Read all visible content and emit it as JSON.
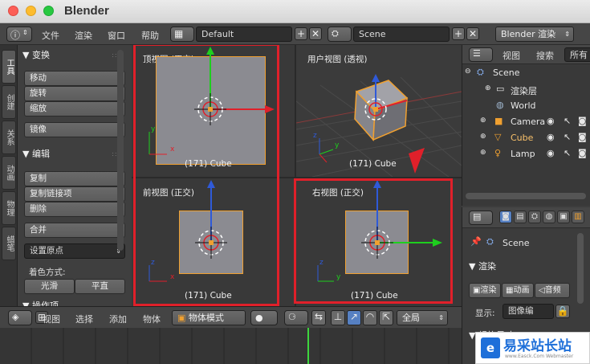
{
  "window": {
    "title": "Blender"
  },
  "infobar": {
    "menus": [
      "文件",
      "渲染",
      "窗口",
      "帮助"
    ],
    "screen_layout": "Default",
    "scene": "Scene",
    "render_engine": "Blender 渲染"
  },
  "left_tabs": [
    "工具",
    "创建",
    "关系",
    "动画",
    "物理",
    "蜡笔"
  ],
  "tool_panel": {
    "transform_header": "▼ 变换",
    "transform_buttons": [
      "移动",
      "旋转",
      "缩放"
    ],
    "mirror": "镜像",
    "edit_header": "▼ 编辑",
    "edit_buttons": [
      "复制",
      "复制链接项",
      "删除"
    ],
    "join": "合并",
    "set_origin": "设置原点",
    "shading_label": "着色方式:",
    "smooth": "光滑",
    "flat": "平直",
    "history_header": "▼ 操作项"
  },
  "viewports": {
    "top": {
      "title": "顶视图 (正交)",
      "object": "(171) Cube"
    },
    "user": {
      "title": "用户视图 (透视)",
      "object": "(171) Cube"
    },
    "front": {
      "title": "前视图 (正交)",
      "object": "(171) Cube"
    },
    "right": {
      "title": "右视图 (正交)",
      "object": "(171) Cube"
    }
  },
  "view_header": {
    "menus": [
      "视图",
      "选择",
      "添加",
      "物体"
    ],
    "mode": "物体模式",
    "orientation": "全局"
  },
  "outliner": {
    "header_menus": [
      "视图",
      "搜索"
    ],
    "filter": "所有",
    "items": [
      {
        "label": "Scene",
        "icon": "scene-icon"
      },
      {
        "label": "渲染层",
        "icon": "render-layer-icon"
      },
      {
        "label": "World",
        "icon": "world-icon"
      },
      {
        "label": "Camera",
        "icon": "camera-icon"
      },
      {
        "label": "Cube",
        "icon": "mesh-icon"
      },
      {
        "label": "Lamp",
        "icon": "lamp-icon"
      }
    ]
  },
  "properties": {
    "scene_label": "Scene",
    "render_header": "▼ 渲染",
    "render_buttons": [
      "渲染",
      "动画",
      "音频"
    ],
    "display_label": "显示:",
    "display_value": "图像编",
    "dimensions_header": "▼ 规格尺寸"
  },
  "watermark": {
    "brand": "易采站长站",
    "url": "www.Easck.Com Webmaster"
  },
  "colors": {
    "accent": "#5680c2",
    "highlight": "#e0202a",
    "selection": "#f0a030"
  }
}
